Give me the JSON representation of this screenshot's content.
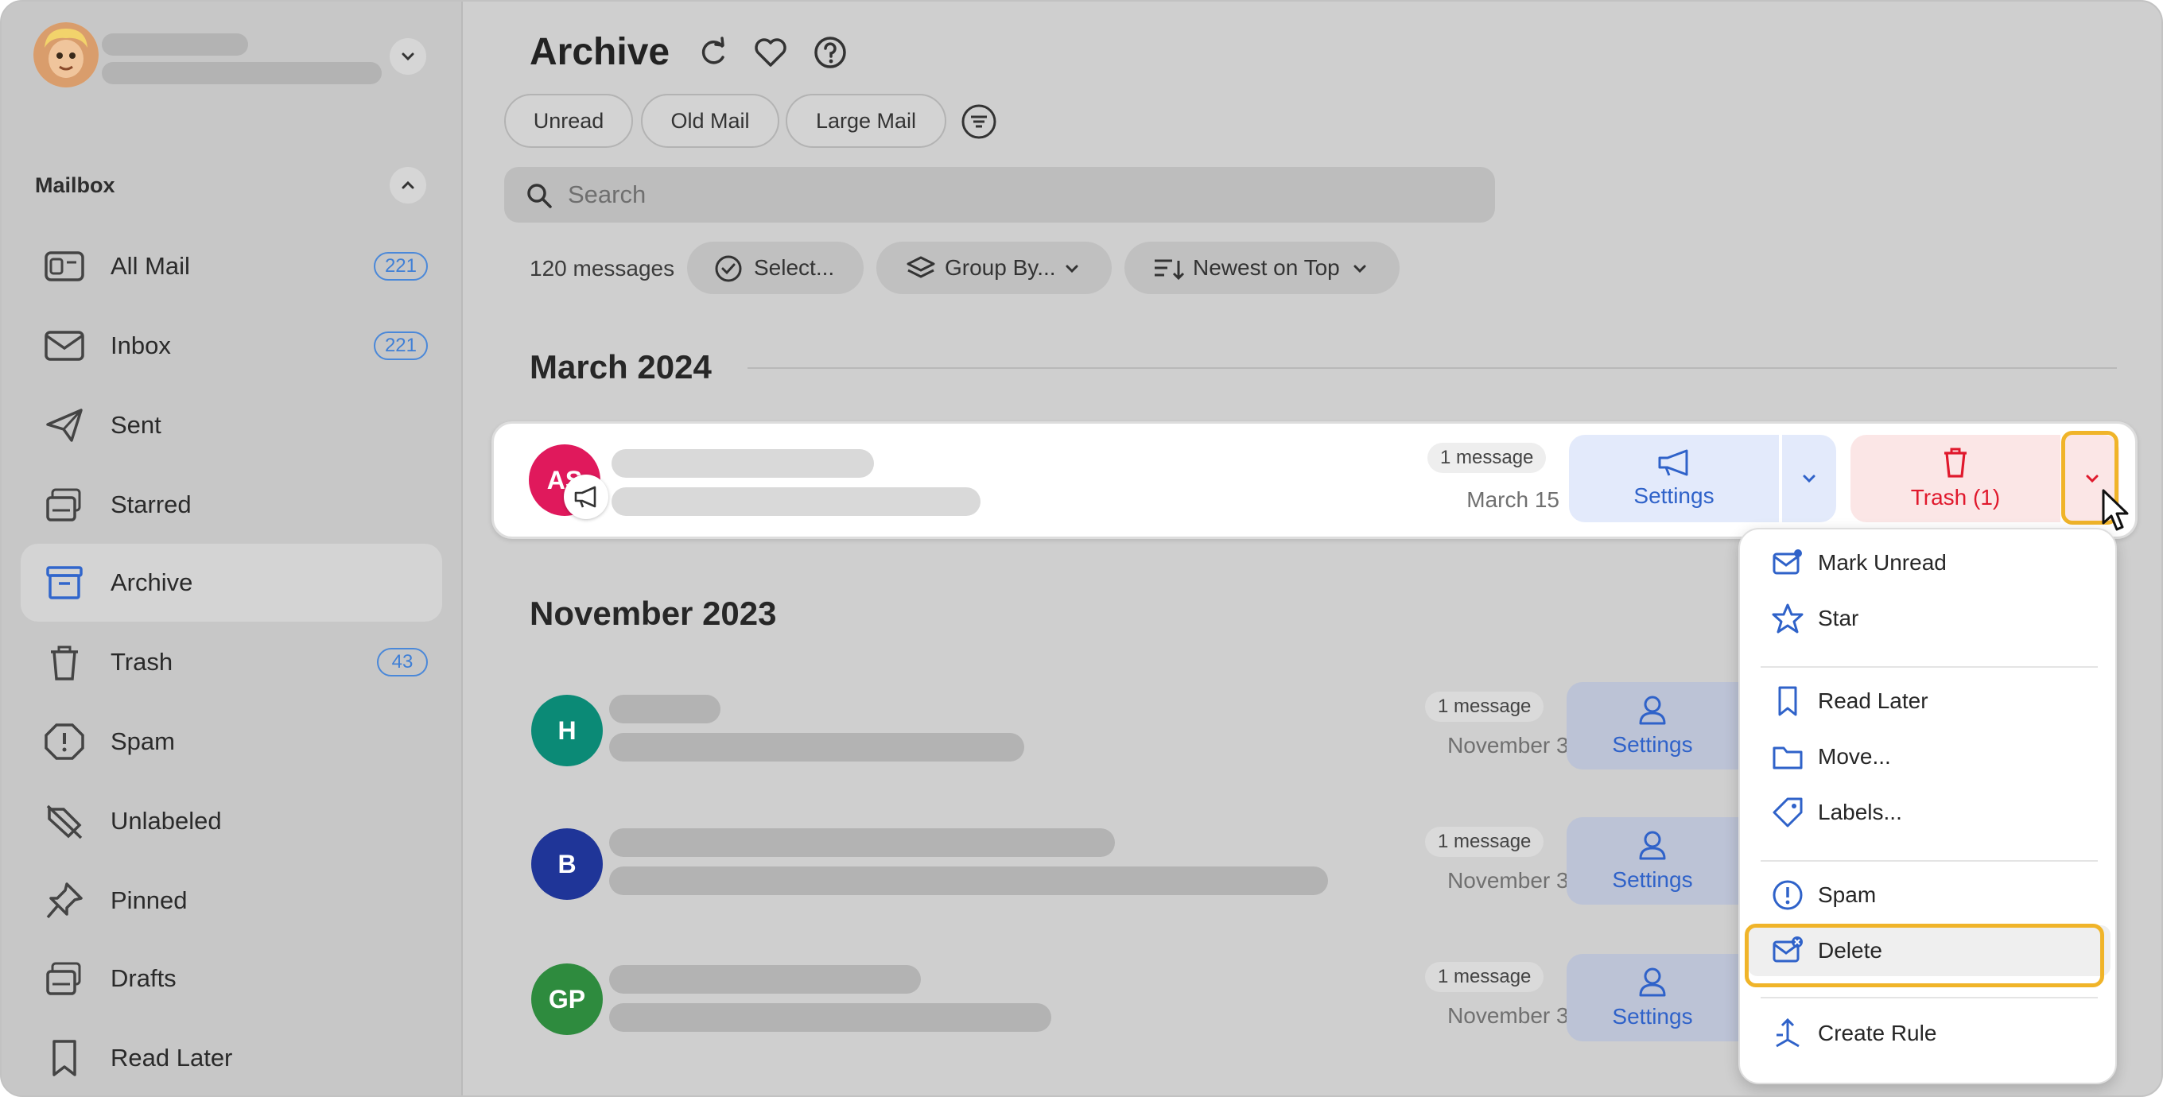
{
  "sidebar": {
    "mailbox_title": "Mailbox",
    "items": [
      {
        "label": "All Mail",
        "badge": "221",
        "icon": "all-mail-icon"
      },
      {
        "label": "Inbox",
        "badge": "221",
        "icon": "inbox-icon"
      },
      {
        "label": "Sent",
        "icon": "sent-icon"
      },
      {
        "label": "Starred",
        "icon": "starred-icon"
      },
      {
        "label": "Archive",
        "icon": "archive-icon",
        "active": true
      },
      {
        "label": "Trash",
        "badge": "43",
        "icon": "trash-icon"
      },
      {
        "label": "Spam",
        "icon": "spam-icon"
      },
      {
        "label": "Unlabeled",
        "icon": "unlabeled-icon"
      },
      {
        "label": "Pinned",
        "icon": "pin-icon"
      },
      {
        "label": "Drafts",
        "icon": "drafts-icon"
      },
      {
        "label": "Read Later",
        "icon": "bookmark-icon"
      }
    ]
  },
  "header": {
    "title": "Archive",
    "filters": [
      "Unread",
      "Old Mail",
      "Large Mail"
    ],
    "search_placeholder": "Search",
    "message_count": "120 messages",
    "select_label": "Select...",
    "group_label": "Group By...",
    "sort_label": "Newest on Top"
  },
  "sections": [
    {
      "title": "March 2024",
      "rows": [
        {
          "initials": "AS",
          "messages": "1 message",
          "date": "March 15",
          "action": "Settings",
          "trash": "Trash (1)",
          "color": "#e0195c"
        }
      ]
    },
    {
      "title": "November 2023",
      "rows": [
        {
          "initials": "H",
          "messages": "1 message",
          "date": "November 30, 2023",
          "action": "Settings",
          "color": "#0b8a76"
        },
        {
          "initials": "B",
          "messages": "1 message",
          "date": "November 30, 2023",
          "action": "Settings",
          "color": "#1f3598"
        },
        {
          "initials": "GP",
          "messages": "1 message",
          "date": "November 30, 2023",
          "action": "Settings",
          "color": "#2e8b3e"
        }
      ]
    }
  ],
  "menu": {
    "items": [
      "Mark Unread",
      "Star",
      "Read Later",
      "Move...",
      "Labels...",
      "Spam",
      "Delete",
      "Create Rule"
    ],
    "highlighted": "Delete"
  },
  "colors": {
    "accent": "#3f7fd6",
    "danger": "#e0192d",
    "highlight": "#f0b429"
  }
}
